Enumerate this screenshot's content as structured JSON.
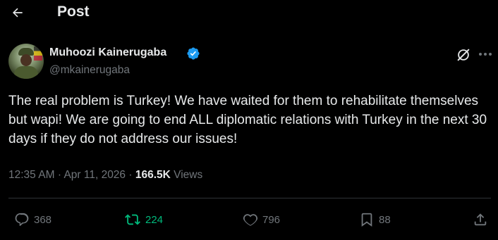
{
  "header": {
    "title": "Post"
  },
  "author": {
    "name": "Muhoozi Kainerugaba",
    "handle": "@mkainerugaba",
    "verified": true
  },
  "post": {
    "text": "The real problem is Turkey! We have waited for them to rehabilitate themselves but wapi! We are going to end ALL diplomatic relations with Turkey in the next 30 days if they do not address our issues!",
    "time": "12:35 AM",
    "separator": "·",
    "date": "Apr 11, 2026",
    "views_count": "166.5K",
    "views_label": "Views"
  },
  "actions": {
    "replies": "368",
    "reposts": "224",
    "likes": "796",
    "bookmarks": "88"
  },
  "colors": {
    "background": "#000000",
    "text": "#e7e9ea",
    "muted": "#71767b",
    "verified": "#1d9bf0",
    "repost_active": "#00ba7c",
    "divider": "#2f3336"
  },
  "icons": {
    "back": "arrow-left-icon",
    "verified": "verified-badge-icon",
    "grok": "grok-icon",
    "more": "more-icon",
    "reply": "reply-icon",
    "repost": "repost-icon",
    "like": "heart-icon",
    "bookmark": "bookmark-icon",
    "share": "share-icon"
  }
}
